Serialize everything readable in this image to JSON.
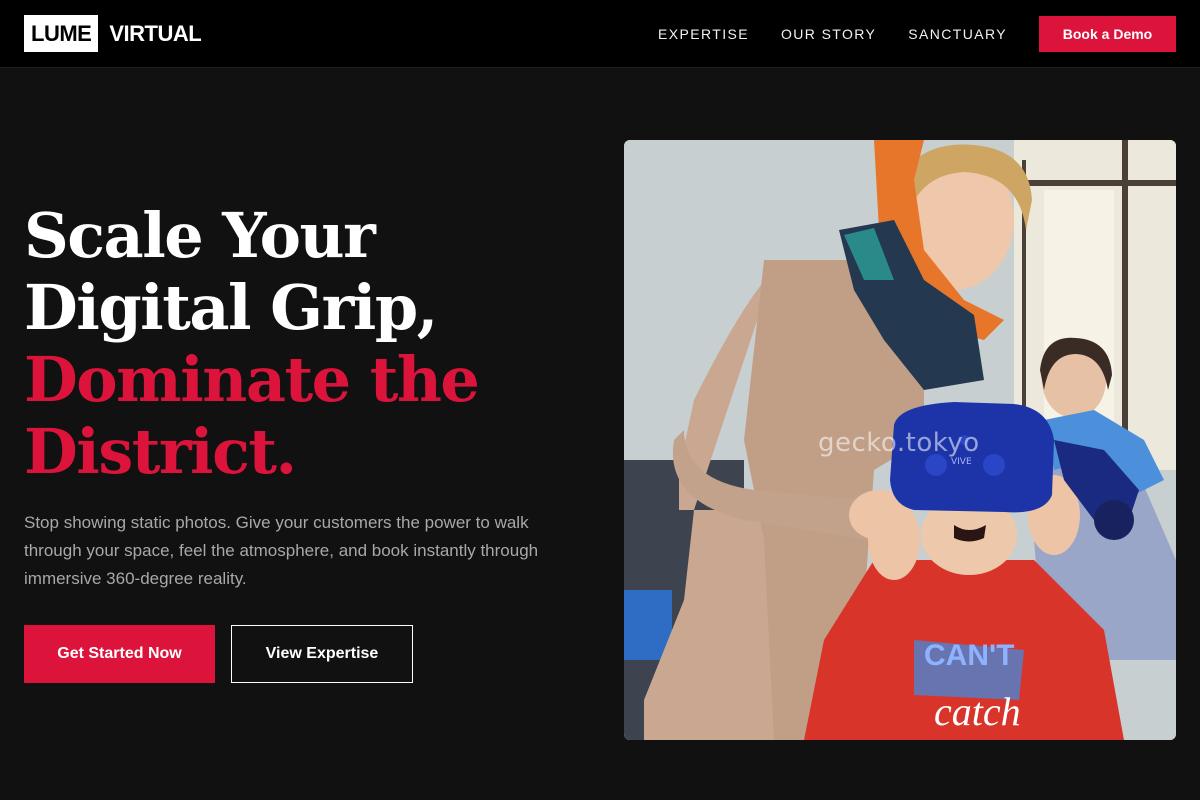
{
  "brand": {
    "box_text": "LUME",
    "text": "VIRTUAL"
  },
  "nav": {
    "links": [
      {
        "label": "EXPERTISE"
      },
      {
        "label": "OUR STORY"
      },
      {
        "label": "SANCTUARY"
      }
    ],
    "cta_label": "Book a Demo"
  },
  "hero": {
    "title_lines": [
      "Scale Your",
      "Digital Grip,"
    ],
    "accent_lines": [
      "Dominate the",
      "District."
    ],
    "subtitle": "Stop showing static photos. Give your customers the power to walk through your space, feel the atmosphere, and book instantly through immersive 360-degree reality.",
    "primary_button": "Get Started Now",
    "secondary_button": "View Expertise"
  },
  "image": {
    "watermark": "gecko.tokyo",
    "headset_label": "VIVE",
    "shirt_text_top": "CAN'T",
    "shirt_text_bottom": "catch"
  },
  "colors": {
    "accent": "#dc143c",
    "background": "#111111",
    "nav_background": "#000000",
    "subtitle": "#a8a8a8"
  }
}
